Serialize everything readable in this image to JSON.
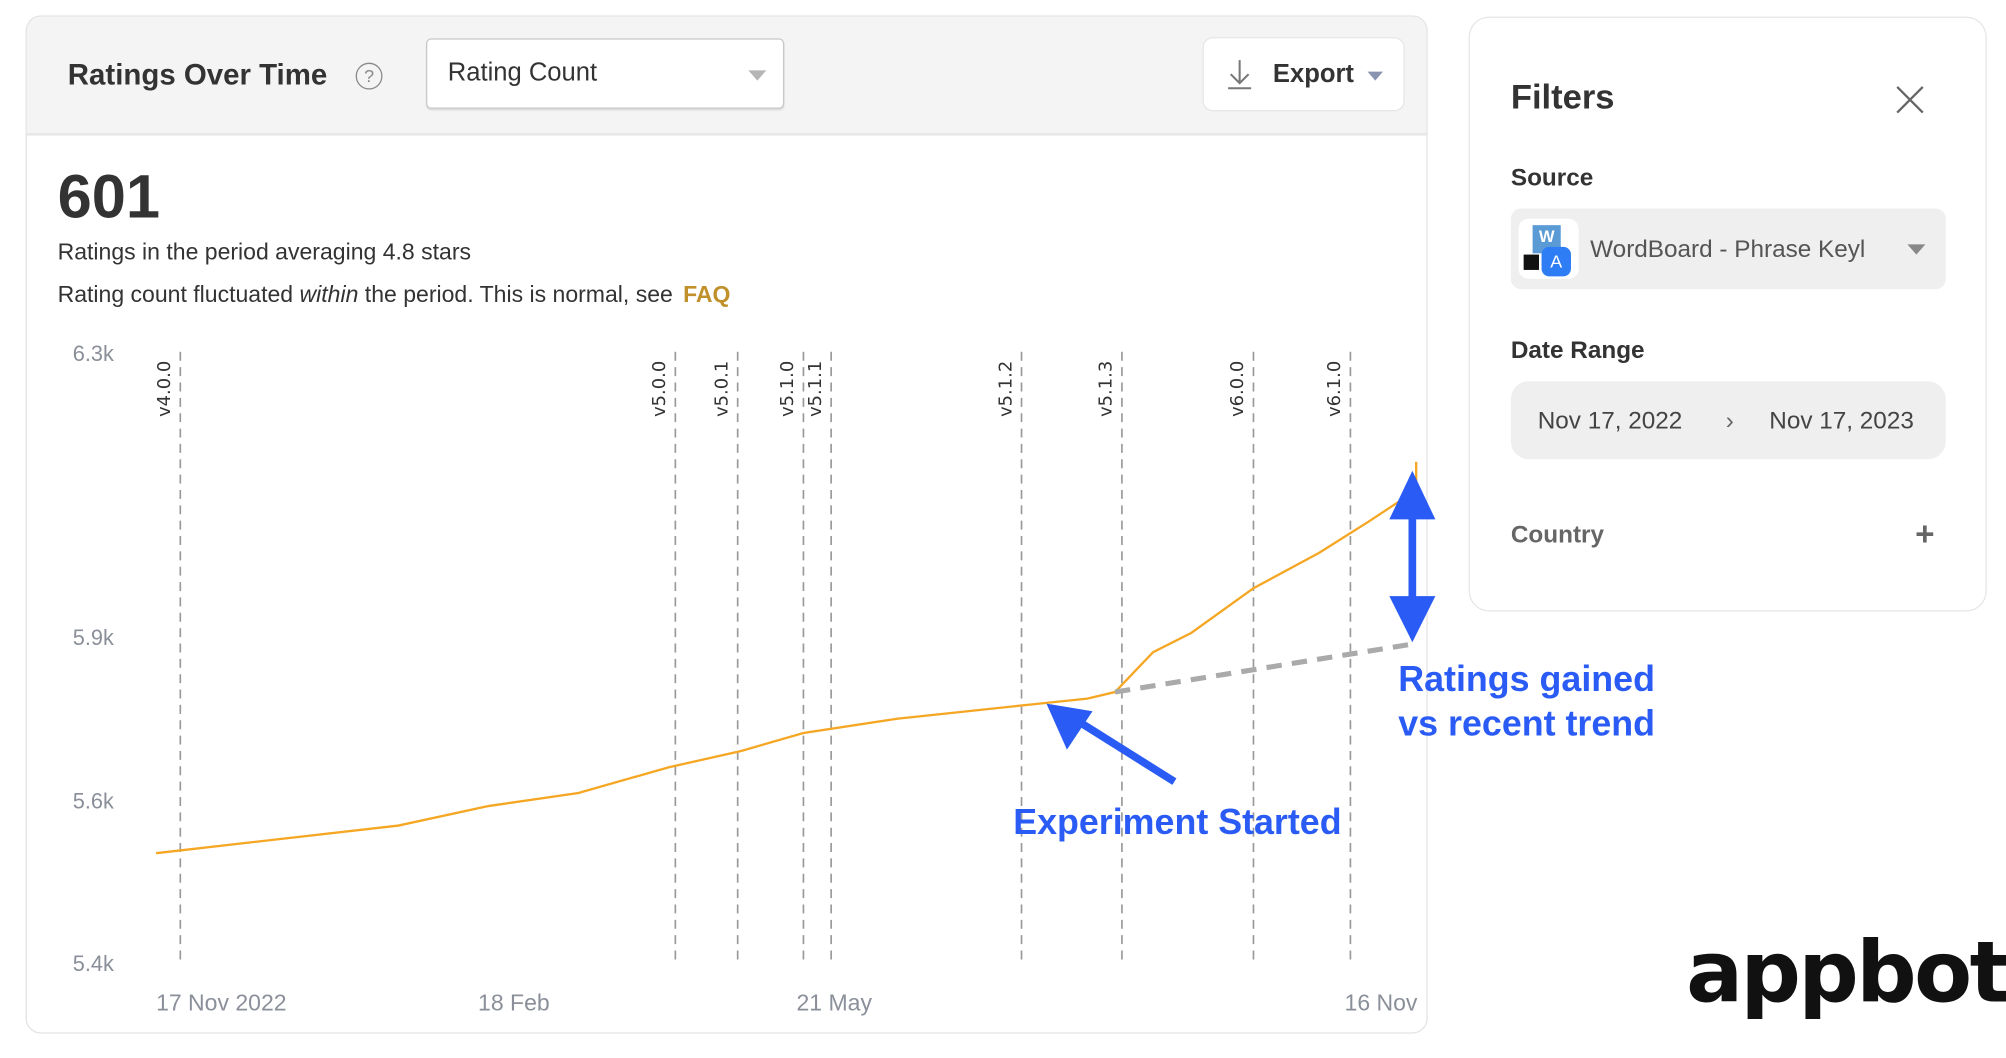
{
  "header": {
    "title": "Ratings Over Time",
    "help_icon": "question-circle-icon",
    "metric_select": "Rating Count",
    "export_label": "Export"
  },
  "summary": {
    "count": "601",
    "line1": "Ratings in the period averaging 4.8 stars",
    "line2_pre": "Rating count fluctuated ",
    "line2_em": "within",
    "line2_post": " the period. This is normal, see",
    "faq_link": "FAQ"
  },
  "filters": {
    "title": "Filters",
    "source_label": "Source",
    "source_value": "WordBoard - Phrase Keyl",
    "date_range_label": "Date Range",
    "date_start": "Nov 17, 2022",
    "date_end": "Nov 17, 2023",
    "country_label": "Country"
  },
  "logo": "appbot",
  "colors": {
    "line": "#f5a623",
    "annotation": "#2a5cf5",
    "trend": "#aaaaaa",
    "faq": "#c0912b"
  },
  "chart_data": {
    "type": "line",
    "y_ticks": [
      {
        "label": "6.3k",
        "value": 6300
      },
      {
        "label": "5.9k",
        "value": 5900
      },
      {
        "label": "5.6k",
        "value": 5600
      },
      {
        "label": "5.4k",
        "value": 5400
      }
    ],
    "x_ticks": [
      {
        "label": "17 Nov 2022",
        "date": "2022-11-17"
      },
      {
        "label": "18 Feb",
        "date": "2023-02-18"
      },
      {
        "label": "21 May",
        "date": "2023-05-21"
      },
      {
        "label": "16 Nov",
        "date": "2023-11-16"
      }
    ],
    "xlim": [
      "2022-11-17",
      "2023-11-16"
    ],
    "ylim": [
      5400,
      6300
    ],
    "grid": false,
    "series": [
      {
        "points": [
          [
            "2022-11-17",
            5534
          ],
          [
            "2023-01-26",
            5568
          ],
          [
            "2023-02-21",
            5592
          ],
          [
            "2023-03-19",
            5612
          ],
          [
            "2023-04-14",
            5659
          ],
          [
            "2023-05-05",
            5689
          ],
          [
            "2023-05-23",
            5722
          ],
          [
            "2023-06-19",
            5748
          ],
          [
            "2023-07-26",
            5773
          ],
          [
            "2023-08-13",
            5785
          ],
          [
            "2023-08-21",
            5797
          ],
          [
            "2023-09-01",
            5870
          ],
          [
            "2023-09-12",
            5904
          ],
          [
            "2023-09-30",
            5967
          ],
          [
            "2023-10-19",
            6017
          ],
          [
            "2023-11-02",
            6060
          ],
          [
            "2023-11-16",
            6105
          ],
          [
            "2023-11-16",
            6145
          ]
        ]
      }
    ],
    "trend": {
      "points": [
        [
          "2023-08-21",
          5797
        ],
        [
          "2023-11-16",
          5886
        ]
      ]
    },
    "releases": [
      {
        "label": "v4.0.0",
        "date": "2022-11-24"
      },
      {
        "label": "v5.0.0",
        "date": "2023-04-16"
      },
      {
        "label": "v5.0.1",
        "date": "2023-05-04"
      },
      {
        "label": "v5.1.0",
        "date": "2023-05-23"
      },
      {
        "label": "v5.1.1",
        "date": "2023-05-31"
      },
      {
        "label": "v5.1.2",
        "date": "2023-07-25"
      },
      {
        "label": "v5.1.3",
        "date": "2023-08-23"
      },
      {
        "label": "v6.0.0",
        "date": "2023-09-30"
      },
      {
        "label": "v6.1.0",
        "date": "2023-10-28"
      }
    ],
    "annotations": {
      "experiment": "Experiment Started",
      "gain_line1": "Ratings gained",
      "gain_line2": "vs recent trend"
    }
  }
}
